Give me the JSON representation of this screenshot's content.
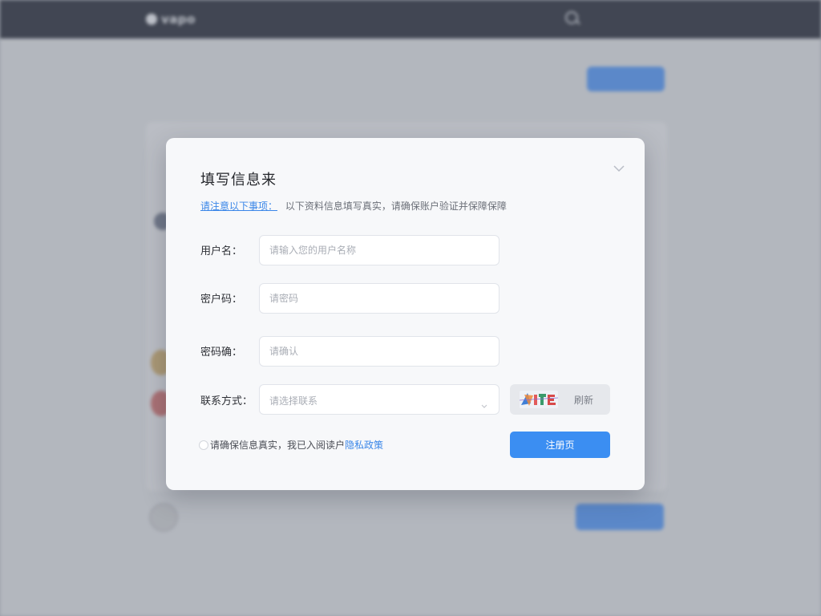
{
  "background": {
    "header": {
      "logo_text": "vapo",
      "nav_links": [
        "",
        ""
      ]
    },
    "subnav": {
      "title": "",
      "tabs": [
        "",
        ""
      ],
      "action_label": ""
    },
    "list_row": {
      "name": "",
      "description": "",
      "link_text": "",
      "action_label": ""
    },
    "footer_text": ""
  },
  "modal": {
    "title": "填写信息来",
    "notice": {
      "link_text": "请注意以下事项：",
      "text": "以下资料信息填写真实，请确保账户验证并保障保障"
    },
    "fields": {
      "username": {
        "label": "用户名：",
        "placeholder": "请输入您的用户名称"
      },
      "password": {
        "label": "密户码：",
        "placeholder": "请密码"
      },
      "confirm": {
        "label": "密码确：",
        "placeholder": "请确认"
      },
      "contact": {
        "label": "联系方式：",
        "placeholder": "请选择联系"
      }
    },
    "captcha": {
      "refresh_label": "刷新"
    },
    "agreement": {
      "text": "请确保信息真实，我已入阅读户",
      "link_text": "隐私政策"
    },
    "submit_label": "注册页"
  },
  "colors": {
    "primary": "#3b8ef2",
    "link": "#3a86e8",
    "header_bg": "#1f2432"
  },
  "icons": {
    "close": "chevron-down-icon",
    "select": "chevron-down-icon",
    "search": "search-icon"
  }
}
